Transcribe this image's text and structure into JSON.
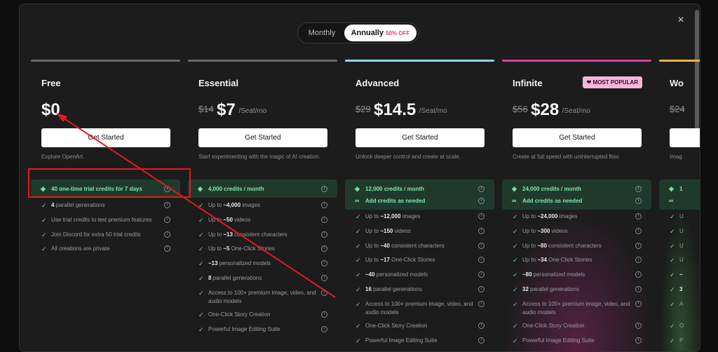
{
  "billing": {
    "monthly": "Monthly",
    "annually": "Annually",
    "discount": "50% OFF"
  },
  "close_icon": "×",
  "plans": [
    {
      "name": "Free",
      "old_price": "",
      "price": "$0",
      "per": "",
      "button": "Get Started",
      "tagline": "Explore OpenArt.",
      "bar_color": "#6a6a6a",
      "badge": "",
      "credits": [
        "40 one-time trial credits for 7 days"
      ],
      "features": [
        {
          "bold": "4",
          "text": " parallel generations"
        },
        {
          "bold": "",
          "text": "Use trial credits to test premium features"
        },
        {
          "bold": "",
          "text": "Join Discord for extra 50 trial credits"
        },
        {
          "bold": "",
          "text": "All creations are private"
        }
      ]
    },
    {
      "name": "Essential",
      "old_price": "$14",
      "price": "$7",
      "per": "/Seat/mo",
      "button": "Get Started",
      "tagline": "Start experimenting with the magic of AI creation.",
      "bar_color": "#6a6a6a",
      "badge": "",
      "credits": [
        "4,000 credits / month"
      ],
      "features": [
        {
          "pre": "Up to ",
          "bold": "~4,000",
          "text": " images"
        },
        {
          "pre": "Up to ",
          "bold": "~50",
          "text": " videos"
        },
        {
          "pre": "Up to ",
          "bold": "~13",
          "text": " consistent characters"
        },
        {
          "pre": "Up to ",
          "bold": "~5",
          "text": " One-Click Stories"
        },
        {
          "pre": "",
          "bold": "~13",
          "text": " personalized models"
        },
        {
          "pre": "",
          "bold": "8",
          "text": " parallel generations"
        },
        {
          "pre": "",
          "bold": "",
          "text": "Access to 100+ premium image, video, and audio models",
          "two": true
        },
        {
          "pre": "",
          "bold": "",
          "text": "One-Click Story Creation"
        },
        {
          "pre": "",
          "bold": "",
          "text": "Powerful Image Editing Suite"
        }
      ]
    },
    {
      "name": "Advanced",
      "old_price": "$29",
      "price": "$14.5",
      "per": "/Seat/mo",
      "button": "Get Started",
      "tagline": "Unlock deeper control and create at scale.",
      "bar_color": "#8fd6ee",
      "badge": "",
      "credits": [
        "12,000 credits / month",
        "Add credits as needed"
      ],
      "features": [
        {
          "pre": "Up to ",
          "bold": "~12,000",
          "text": " images"
        },
        {
          "pre": "Up to ",
          "bold": "~150",
          "text": " videos"
        },
        {
          "pre": "Up to ",
          "bold": "~40",
          "text": " consistent characters"
        },
        {
          "pre": "Up to ",
          "bold": "~17",
          "text": " One-Click Stories"
        },
        {
          "pre": "",
          "bold": "~40",
          "text": " personalized models"
        },
        {
          "pre": "",
          "bold": "16",
          "text": " parallel generations"
        },
        {
          "pre": "",
          "bold": "",
          "text": "Access to 100+ premium image, video, and audio models",
          "two": true
        },
        {
          "pre": "",
          "bold": "",
          "text": "One-Click Story Creation"
        },
        {
          "pre": "",
          "bold": "",
          "text": "Powerful Image Editing Suite"
        }
      ]
    },
    {
      "name": "Infinite",
      "old_price": "$56",
      "price": "$28",
      "per": "/Seat/mo",
      "button": "Get Started",
      "tagline": "Create at full speed with uninterrupted flow.",
      "bar_color": "#d63fa0",
      "badge": "MOST POPULAR",
      "credits": [
        "24,000 credits / month",
        "Add credits as needed"
      ],
      "features": [
        {
          "pre": "Up to ",
          "bold": "~24,000",
          "text": " images"
        },
        {
          "pre": "Up to ",
          "bold": "~300",
          "text": " videos"
        },
        {
          "pre": "Up to ",
          "bold": "~80",
          "text": " consistent characters"
        },
        {
          "pre": "Up to ",
          "bold": "~34",
          "text": " One-Click Stories"
        },
        {
          "pre": "",
          "bold": "~80",
          "text": " personalized models"
        },
        {
          "pre": "",
          "bold": "32",
          "text": " parallel generations"
        },
        {
          "pre": "",
          "bold": "",
          "text": "Access to 100+ premium image, video, and audio models",
          "two": true
        },
        {
          "pre": "",
          "bold": "",
          "text": "One-Click Story Creation"
        },
        {
          "pre": "",
          "bold": "",
          "text": "Powerful Image Editing Suite"
        }
      ]
    },
    {
      "name": "Wo",
      "old_price": "$24",
      "price": "",
      "per": "",
      "button": "",
      "tagline": "Imag",
      "bar_color": "#e8b83a",
      "badge": "",
      "credits": [
        "1",
        ""
      ],
      "features": [
        {
          "pre": "U",
          "bold": "",
          "text": ""
        },
        {
          "pre": "U",
          "bold": "",
          "text": ""
        },
        {
          "pre": "U",
          "bold": "",
          "text": ""
        },
        {
          "pre": "U",
          "bold": "",
          "text": ""
        },
        {
          "pre": "",
          "bold": "~",
          "text": ""
        },
        {
          "pre": "",
          "bold": "3",
          "text": ""
        },
        {
          "pre": "",
          "bold": "",
          "text": "A",
          "two": true
        },
        {
          "pre": "",
          "bold": "",
          "text": "O"
        },
        {
          "pre": "",
          "bold": "",
          "text": "P"
        }
      ]
    }
  ]
}
